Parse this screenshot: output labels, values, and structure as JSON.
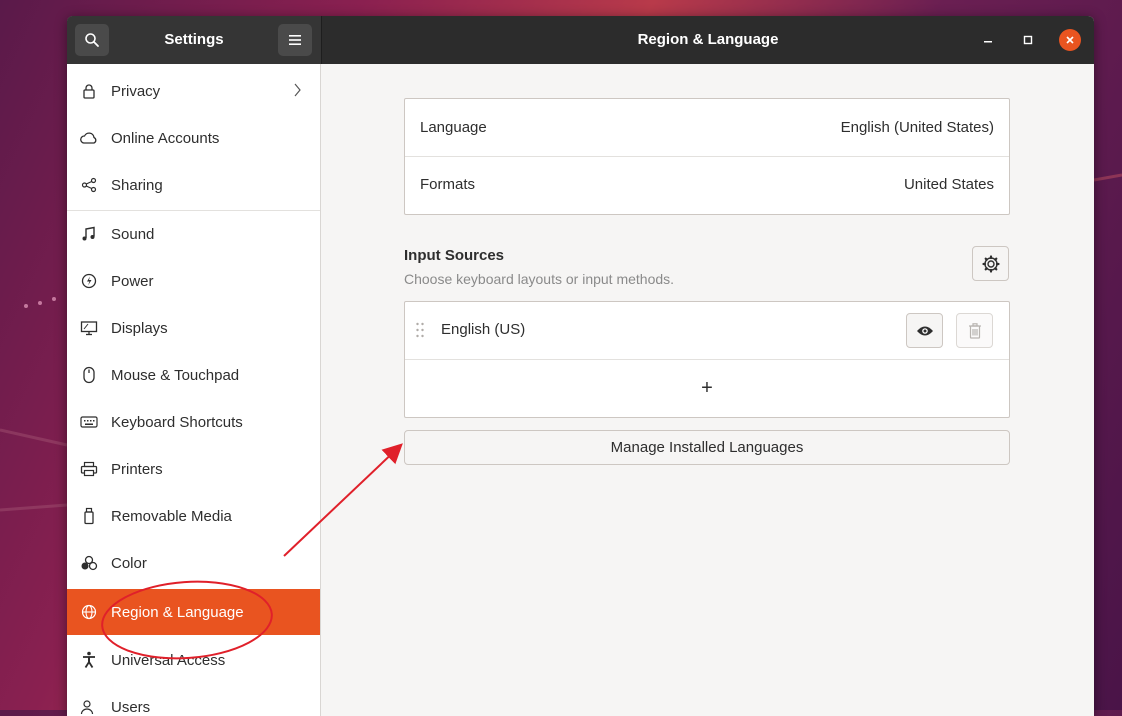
{
  "titlebar": {
    "sidebar_title": "Settings",
    "main_title": "Region & Language"
  },
  "sidebar": {
    "items": [
      {
        "label": "Privacy",
        "icon": "lock-icon"
      },
      {
        "label": "Online Accounts",
        "icon": "cloud-icon"
      },
      {
        "label": "Sharing",
        "icon": "share-icon"
      },
      {
        "label": "Sound",
        "icon": "music-note-icon"
      },
      {
        "label": "Power",
        "icon": "power-icon"
      },
      {
        "label": "Displays",
        "icon": "display-icon"
      },
      {
        "label": "Mouse & Touchpad",
        "icon": "mouse-icon"
      },
      {
        "label": "Keyboard Shortcuts",
        "icon": "keyboard-icon"
      },
      {
        "label": "Printers",
        "icon": "printer-icon"
      },
      {
        "label": "Removable Media",
        "icon": "removable-media-icon"
      },
      {
        "label": "Color",
        "icon": "color-icon"
      },
      {
        "label": "Region & Language",
        "icon": "globe-icon",
        "active": true
      },
      {
        "label": "Universal Access",
        "icon": "accessibility-icon"
      },
      {
        "label": "Users",
        "icon": "users-icon"
      }
    ]
  },
  "main": {
    "language": {
      "label": "Language",
      "value": "English (United States)"
    },
    "formats": {
      "label": "Formats",
      "value": "United States"
    },
    "input_sources": {
      "title": "Input Sources",
      "subtitle": "Choose keyboard layouts or input methods.",
      "sources": [
        {
          "label": "English (US)"
        }
      ],
      "add_label": "+"
    },
    "manage_button": "Manage Installed Languages"
  },
  "colors": {
    "accent": "#e95420",
    "titlebar": "#2c2c2c",
    "annotation": "#e0202a"
  }
}
